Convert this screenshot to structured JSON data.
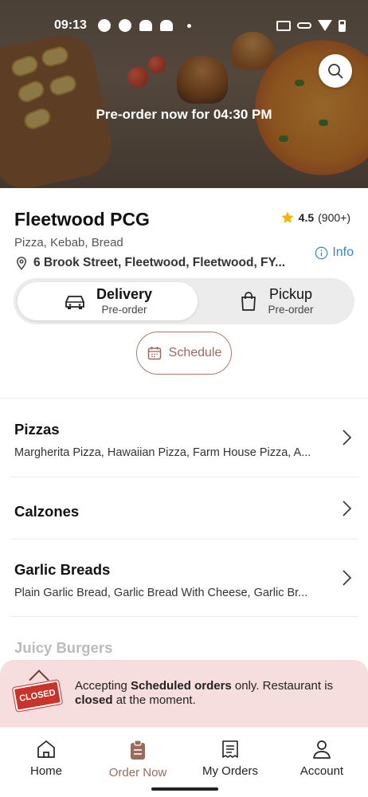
{
  "status_bar": {
    "time": "09:13"
  },
  "hero": {
    "preorder_text": "Pre-order now for 04:30 PM"
  },
  "restaurant": {
    "name": "Fleetwood PCG",
    "rating_score": "4.5",
    "rating_count": "(900+)",
    "cuisine": "Pizza, Kebab, Bread",
    "address": "6 Brook Street, Fleetwood, Fleetwood, FY...",
    "info_label": "Info"
  },
  "order_mode": {
    "delivery_label": "Delivery",
    "delivery_sub": "Pre-order",
    "pickup_label": "Pickup",
    "pickup_sub": "Pre-order",
    "selected": "Delivery"
  },
  "schedule_label": "Schedule",
  "categories": [
    {
      "title": "Pizzas",
      "desc": "Margherita Pizza, Hawaiian Pizza, Farm House Pizza, A..."
    },
    {
      "title": "Calzones",
      "desc": ""
    },
    {
      "title": "Garlic Breads",
      "desc": "Plain Garlic Bread, Garlic Bread With Cheese, Garlic Br..."
    },
    {
      "title": "Juicy Burgers",
      "desc": ""
    }
  ],
  "closed_banner": {
    "sign_text": "CLOSED",
    "text_1": "Accepting ",
    "text_bold_1": "Scheduled orders",
    "text_2": " only. Restaurant is ",
    "text_bold_2": "closed",
    "text_3": " at the moment."
  },
  "bottom_nav": [
    {
      "label": "Home",
      "icon": "home-icon"
    },
    {
      "label": "Order Now",
      "icon": "order-icon",
      "active": true
    },
    {
      "label": "My Orders",
      "icon": "receipt-icon"
    },
    {
      "label": "Account",
      "icon": "user-icon"
    }
  ],
  "colors": {
    "accent": "#9a6b5c",
    "info_blue": "#3b82c4",
    "closed_bg": "#f6dede",
    "closed_sign": "#c8342b",
    "star": "#f2b705"
  }
}
